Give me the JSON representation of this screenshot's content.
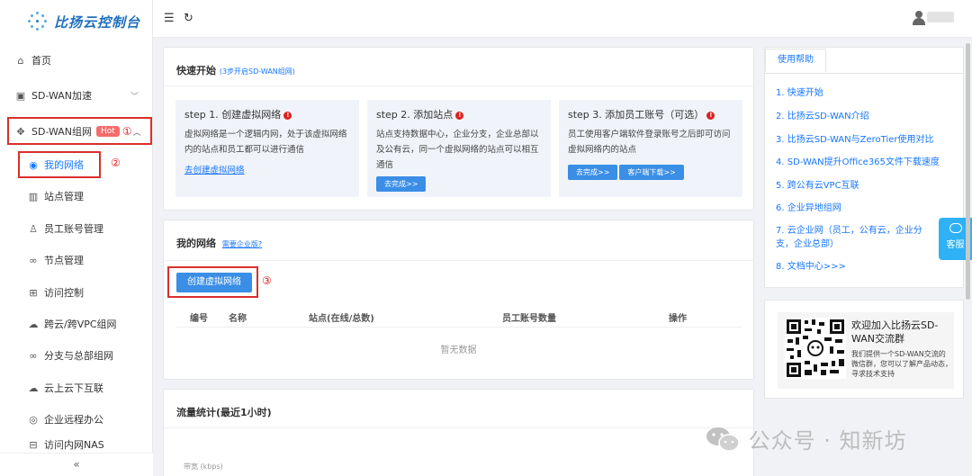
{
  "app": {
    "logo_text": "比扬云控制台"
  },
  "sidebar": {
    "items": [
      {
        "label": "首页",
        "icon": "home-icon"
      },
      {
        "label": "SD-WAN加速",
        "icon": "chip-icon"
      },
      {
        "label": "SD-WAN组网",
        "icon": "network-icon",
        "badge": "Hot",
        "annotation": "①"
      },
      {
        "label": "我的网络",
        "icon": "target-icon",
        "annotation": "②"
      },
      {
        "label": "站点管理",
        "icon": "building-icon"
      },
      {
        "label": "员工账号管理",
        "icon": "user-icon"
      },
      {
        "label": "节点管理",
        "icon": "link-icon"
      },
      {
        "label": "访问控制",
        "icon": "access-control-icon"
      },
      {
        "label": "跨云/跨VPC组网",
        "icon": "cloud-icon"
      },
      {
        "label": "分支与总部组网",
        "icon": "link-icon"
      },
      {
        "label": "云上云下互联",
        "icon": "cloud-icon"
      },
      {
        "label": "企业远程办公",
        "icon": "person-circle-icon"
      },
      {
        "label": "访问内网NAS",
        "icon": "nas-icon"
      }
    ],
    "collapse_glyph": "«"
  },
  "quickstart": {
    "title": "快速开始",
    "subtitle": "(3步开启SD-WAN组网)",
    "steps": [
      {
        "title": "step 1. 创建虚拟网络",
        "desc": "虚拟网络是一个逻辑内网，处于该虚拟网络内的站点和员工都可以进行通信",
        "link": "去创建虚拟网络"
      },
      {
        "title": "step 2. 添加站点",
        "desc": "站点支持数据中心，企业分支，企业总部以及公有云，同一个虚拟网络的站点可以相互通信",
        "button": "去完成>>"
      },
      {
        "title": "step 3. 添加员工账号（可选）",
        "desc": "员工使用客户端软件登录账号之后即可访问虚拟网络内的站点",
        "button": "去完成>>",
        "button2": "客户端下载>>"
      }
    ]
  },
  "my_network": {
    "title": "我的网络",
    "enterprise_link": "需要企业版?",
    "create_button": "创建虚拟网络",
    "annotation": "③",
    "columns": [
      "编号",
      "名称",
      "站点(在线/总数)",
      "员工账号数量",
      "操作"
    ],
    "empty_text": "暂无数据"
  },
  "traffic": {
    "title": "流量统计(最近1小时)",
    "axis_label": "带宽 (kbps)"
  },
  "help": {
    "tab": "使用帮助",
    "items": [
      "1. 快速开始",
      "2. 比扬云SD-WAN介绍",
      "3. 比扬云SD-WAN与ZeroTier使用对比",
      "4. SD-WAN提升Office365文件下载速度",
      "5. 跨公有云VPC互联",
      "6. 企业异地组网",
      "7. 云企业网（员工，公有云，企业分支，企业总部）",
      "8. 文档中心>>>"
    ]
  },
  "wechat": {
    "title": "欢迎加入比扬云SD-WAN交流群",
    "desc": "我们提供一个SD-WAN交流的微信群，您可以了解产品动态，寻求技术支持"
  },
  "float_service": {
    "label": "客服"
  },
  "watermark": "公众号 · 知新坊"
}
